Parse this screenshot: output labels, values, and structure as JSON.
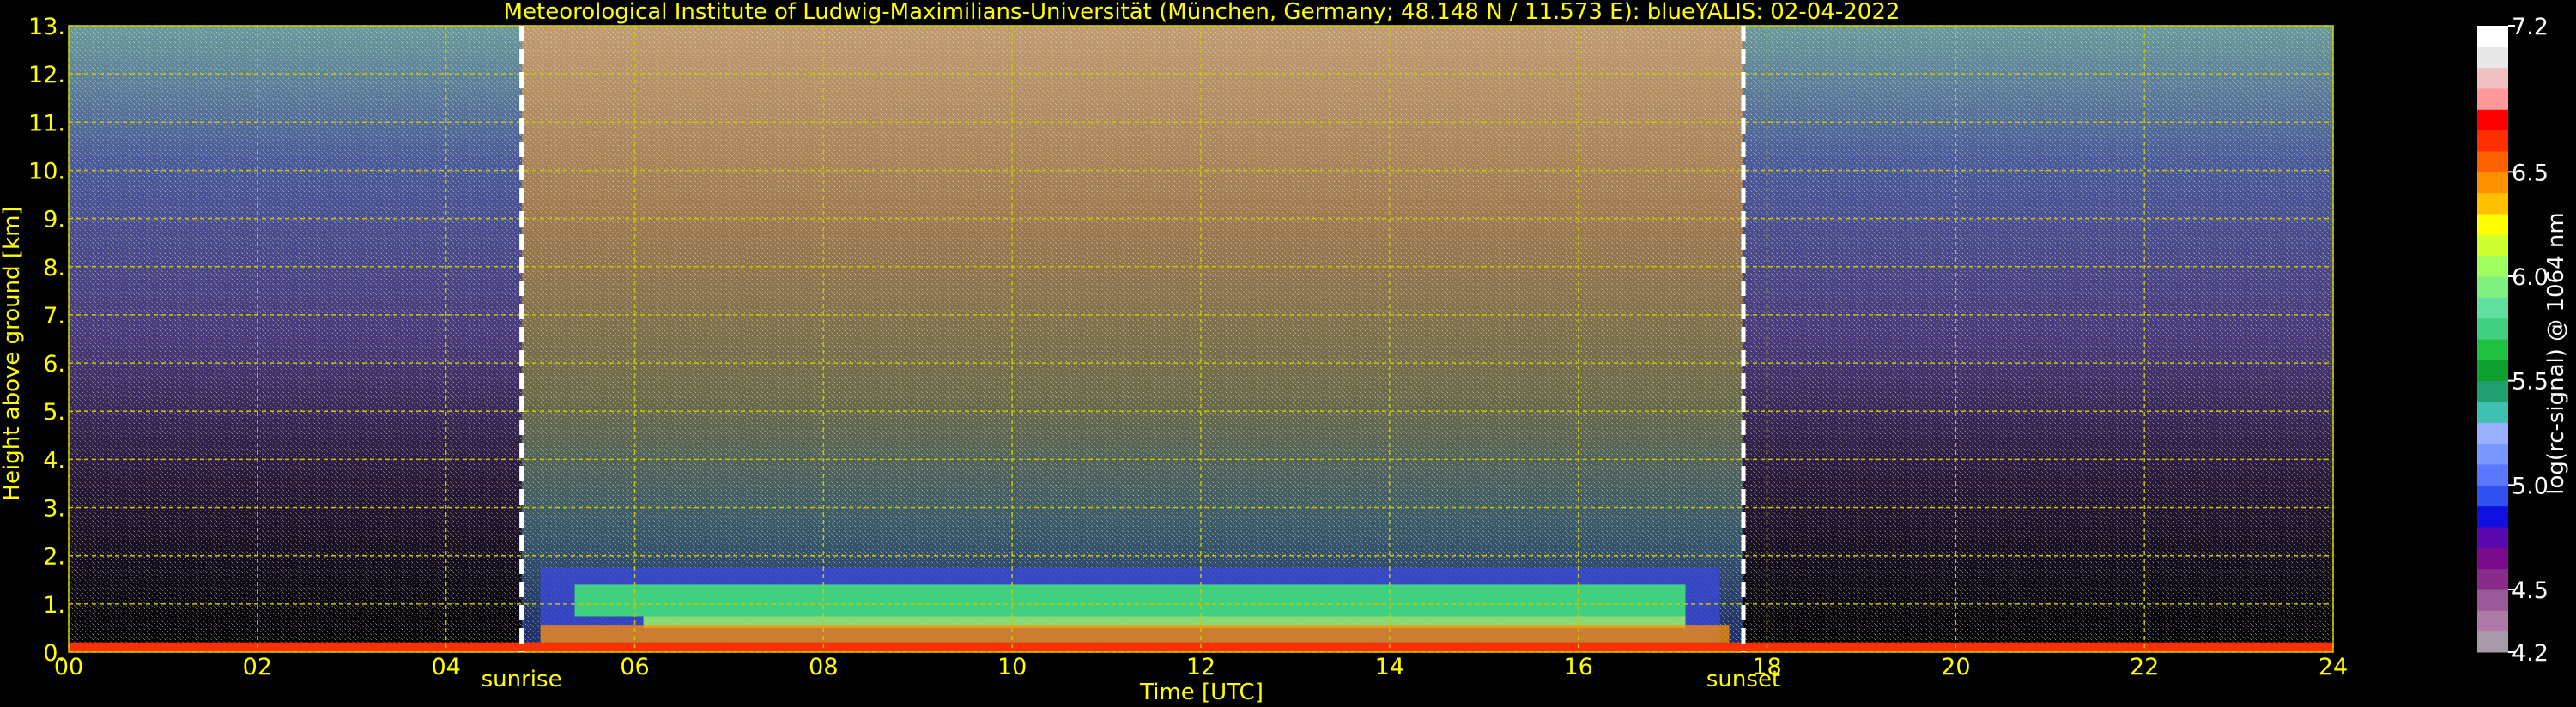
{
  "chart_data": {
    "type": "heatmap",
    "title": "Meteorological Institute of Ludwig-Maximilians-Universität (München, Germany; 48.148 N / 11.573 E):    blueYALIS: 02-04-2022",
    "xlabel": "Time [UTC]",
    "ylabel": "Height above ground [km]",
    "xlim": [
      0,
      24
    ],
    "ylim": [
      0,
      13
    ],
    "x_ticks": [
      "00",
      "02",
      "04",
      "06",
      "08",
      "10",
      "12",
      "14",
      "16",
      "18",
      "20",
      "22",
      "24"
    ],
    "y_ticks": [
      "0.",
      "1.",
      "2.",
      "3.",
      "4.",
      "5.",
      "6.",
      "7.",
      "8.",
      "9.",
      "10.",
      "11.",
      "12.",
      "13."
    ],
    "grid": true,
    "markers": [
      {
        "label": "sunrise",
        "x": 4.8
      },
      {
        "label": "sunset",
        "x": 17.75
      }
    ],
    "colorbar": {
      "label": "log(rc-signal) @ 1064 nm",
      "range": [
        4.2,
        7.2
      ],
      "ticks": [
        "4.2",
        "4.5",
        "5.0",
        "5.5",
        "6.0",
        "6.5",
        "7.2"
      ],
      "colors": [
        "#a89aa8",
        "#b07aa8",
        "#9a5a9a",
        "#8a2a8a",
        "#7a0a8a",
        "#5a08b0",
        "#1010e0",
        "#3050f0",
        "#5a78ff",
        "#7898ff",
        "#98b0ff",
        "#40c0b0",
        "#20a070",
        "#10a030",
        "#20c040",
        "#40d080",
        "#60e0a0",
        "#80f080",
        "#a0ff60",
        "#d0ff30",
        "#ffff00",
        "#ffc000",
        "#ff9000",
        "#ff6000",
        "#ff3000",
        "#ff0000",
        "#ff9898",
        "#f0c0c0",
        "#e8e8e8",
        "#ffffff"
      ]
    },
    "regions": [
      {
        "label": "night background",
        "x": [
          0,
          4.8
        ],
        "noise": "blue-purple"
      },
      {
        "label": "daylight background",
        "x": [
          4.8,
          17.75
        ],
        "noise": "orange-white"
      },
      {
        "label": "aerosol layer",
        "x": [
          5.0,
          17.5
        ],
        "y": [
          0.2,
          1.4
        ],
        "value": 6.0
      },
      {
        "label": "night background",
        "x": [
          17.75,
          24
        ],
        "noise": "blue-purple"
      }
    ]
  }
}
